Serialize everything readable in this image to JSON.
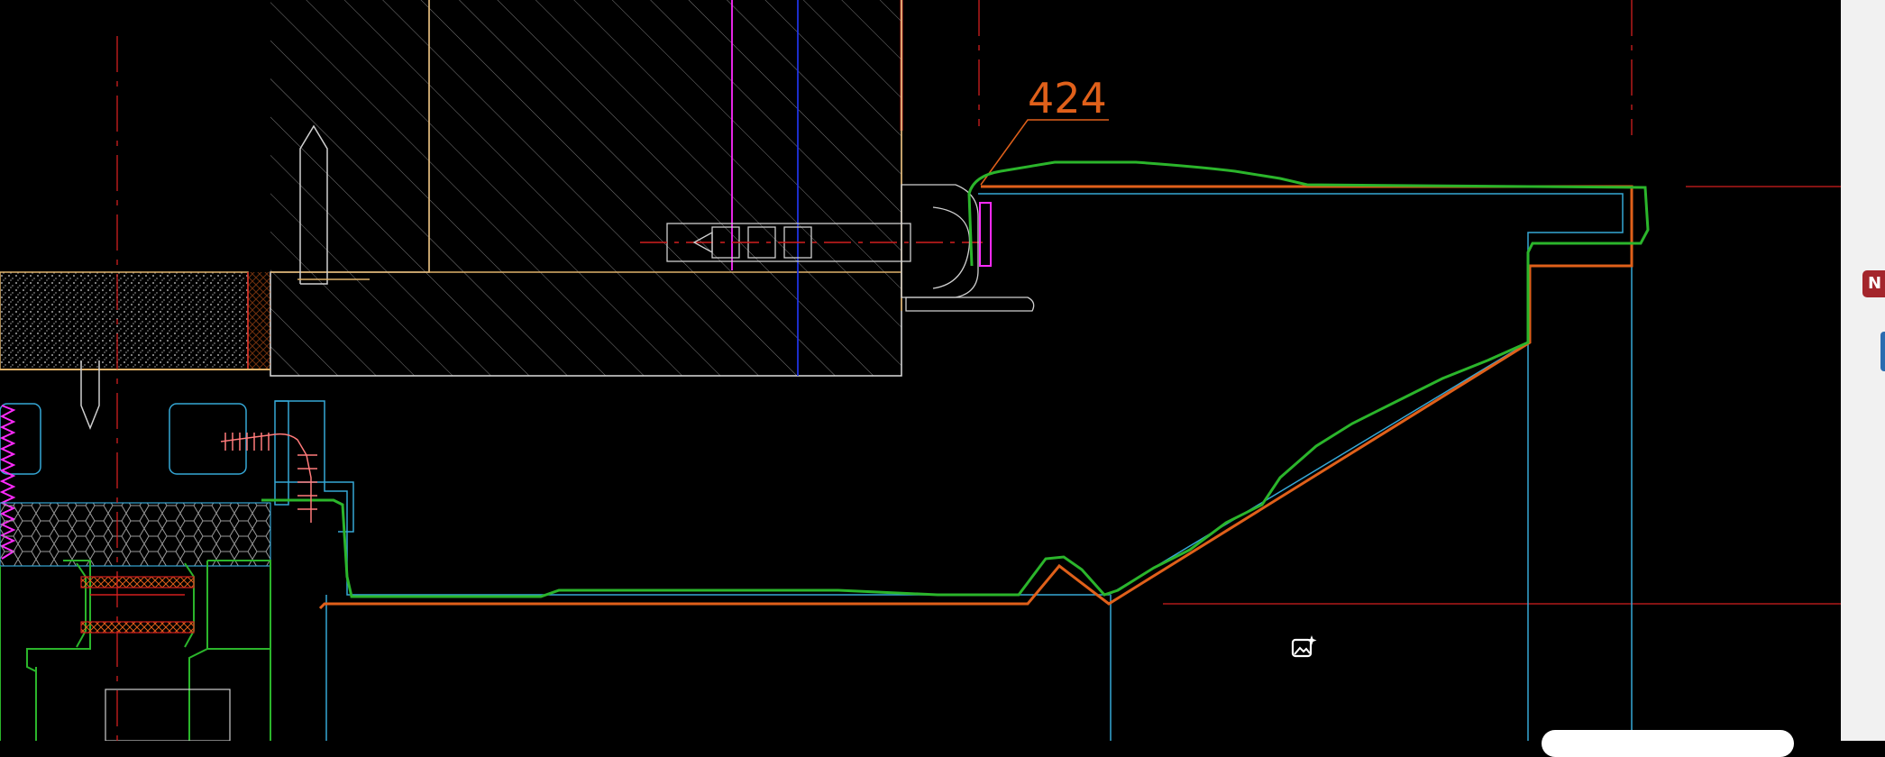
{
  "drawing": {
    "dimension_label": "424"
  },
  "colors": {
    "background": "#000000",
    "red_line": "#d21f1f",
    "orange": "#e0601a",
    "green": "#2bb52b",
    "cyan": "#35a7d6",
    "magenta": "#ff2bff",
    "blue": "#2033e0",
    "tan": "#e0b26a",
    "white": "#dddddd"
  },
  "right_panel": {
    "badge_text": "N"
  },
  "icons": {
    "ai_image": "image-sparkle-icon"
  }
}
